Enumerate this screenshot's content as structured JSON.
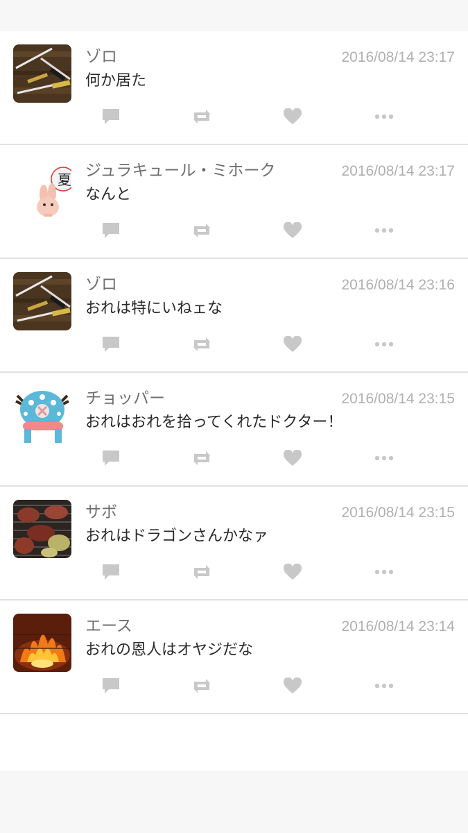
{
  "colors": {
    "background": "#f7f7f7",
    "card": "#ffffff",
    "divider": "#e1e1e1",
    "name_text": "#6f6f6f",
    "timestamp_text": "#b0b0b0",
    "body_text": "#2a2a2a",
    "action_icon": "#c8c8c8"
  },
  "posts": [
    {
      "name": "ゾロ",
      "timestamp": "2016/08/14 23:17",
      "text": "何か居た",
      "avatar": "swords-avatar"
    },
    {
      "name": "ジュラキュール・ミホーク",
      "timestamp": "2016/08/14 23:17",
      "text": "なんと",
      "avatar": "rabbit-sticker-avatar"
    },
    {
      "name": "ゾロ",
      "timestamp": "2016/08/14 23:16",
      "text": "おれは特にいねェな",
      "avatar": "swords-avatar"
    },
    {
      "name": "チョッパー",
      "timestamp": "2016/08/14 23:15",
      "text": "おれはおれを拾ってくれたドクター！",
      "avatar": "chopper-hat-avatar"
    },
    {
      "name": "サボ",
      "timestamp": "2016/08/14 23:15",
      "text": "おれはドラゴンさんかなァ",
      "avatar": "grilled-meat-avatar"
    },
    {
      "name": "エース",
      "timestamp": "2016/08/14 23:14",
      "text": "おれの恩人はオヤジだな",
      "avatar": "fire-grill-avatar"
    }
  ],
  "actions": [
    "reply-icon",
    "retweet-icon",
    "like-icon",
    "more-icon"
  ]
}
